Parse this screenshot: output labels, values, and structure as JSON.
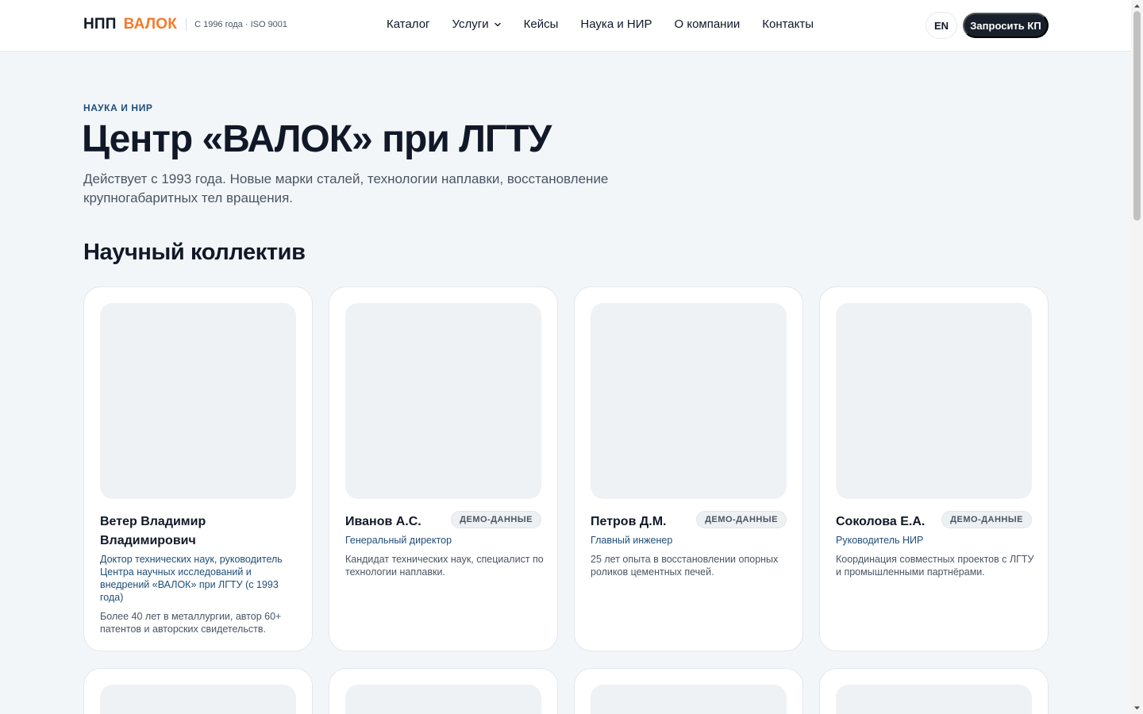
{
  "header": {
    "brand_npp": "НПП",
    "brand_valok": "ВАЛОК",
    "brand_tagline": "С 1996 года · ISO 9001",
    "nav": [
      "Каталог",
      "Услуги",
      "Кейсы",
      "Наука и НИР",
      "О компании",
      "Контакты"
    ],
    "lang": "EN",
    "cta": "Запросить КП"
  },
  "hero": {
    "eyebrow": "НАУКА И НИР",
    "title": "Центр «ВАЛОК» при ЛГТУ",
    "description": "Действует с 1993 года. Новые марки сталей, технологии наплавки, восстановление крупногабаритных тел вращения."
  },
  "team": {
    "title": "Научный коллектив",
    "members": [
      {
        "name": "Ветер Владимир Владимирович",
        "badge": "",
        "role": "Доктор технических наук, руководитель Центра научных исследований и внедрений «ВАЛОК» при ЛГТУ (с 1993 года)",
        "bio": "Более 40 лет в металлургии, автор 60+ патентов и авторских свидетельств."
      },
      {
        "name": "Иванов А.С.",
        "badge": "ДЕМО-ДАННЫЕ",
        "role": "Генеральный директор",
        "bio": "Кандидат технических наук, специалист по технологии наплавки."
      },
      {
        "name": "Петров Д.М.",
        "badge": "ДЕМО-ДАННЫЕ",
        "role": "Главный инженер",
        "bio": "25 лет опыта в восстановлении опорных роликов цементных печей."
      },
      {
        "name": "Соколова Е.А.",
        "badge": "ДЕМО-ДАННЫЕ",
        "role": "Руководитель НИР",
        "bio": "Координация совместных проектов с ЛГТУ и промышленными партнёрами."
      }
    ]
  },
  "colors": {
    "accent": "#f47a2b",
    "link": "#1f4e79",
    "background": "#f2f6f9",
    "dark_button": "#18202b"
  }
}
